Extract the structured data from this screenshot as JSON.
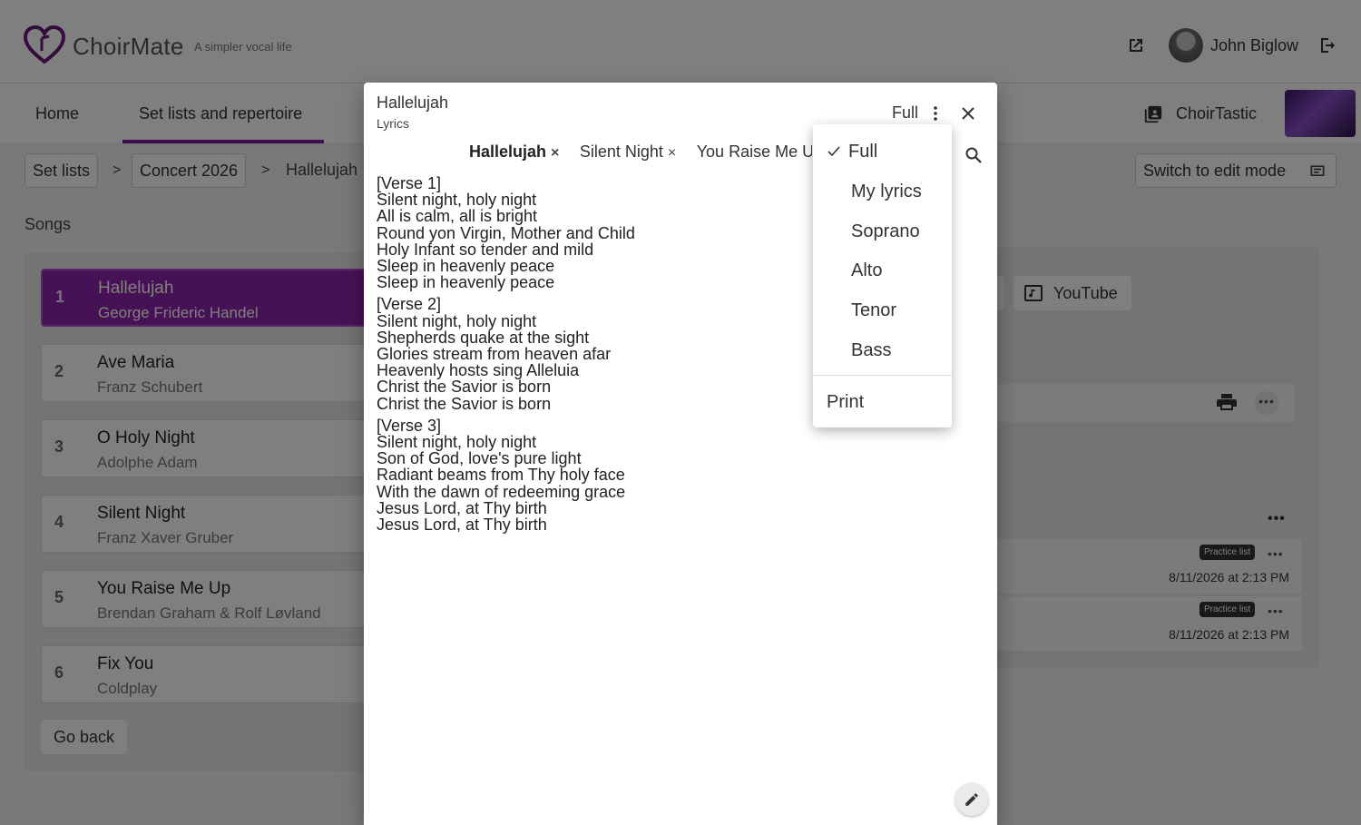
{
  "header": {
    "brand": "ChoirMate",
    "tagline": "A simpler vocal life",
    "user_name": "John Biglow"
  },
  "nav": {
    "tabs": [
      {
        "label": "Home"
      },
      {
        "label": "Set lists and repertoire"
      }
    ],
    "choir_name": "ChoirTastic"
  },
  "breadcrumb": {
    "items": [
      "Set lists",
      "Concert 2026",
      "Hallelujah"
    ],
    "separator": ">"
  },
  "edit_mode_label": "Switch to edit mode",
  "songs_heading": "Songs",
  "songs": [
    {
      "num": "1",
      "title": "Hallelujah",
      "composer": "George Frideric Handel"
    },
    {
      "num": "2",
      "title": "Ave Maria",
      "composer": "Franz Schubert"
    },
    {
      "num": "3",
      "title": "O Holy Night",
      "composer": "Adolphe Adam"
    },
    {
      "num": "4",
      "title": "Silent Night",
      "composer": "Franz Xaver Gruber"
    },
    {
      "num": "5",
      "title": "You Raise Me Up",
      "composer": "Brendan Graham & Rolf Løvland"
    },
    {
      "num": "6",
      "title": "Fix You",
      "composer": "Coldplay"
    }
  ],
  "go_back_label": "Go back",
  "details": {
    "youtube_label": "YouTube",
    "more_dots": "•••",
    "practice_rows": [
      {
        "badge": "Practice list",
        "date": "8/11/2026 at 2:13 PM"
      },
      {
        "badge": "Practice list",
        "date": "8/11/2026 at 2:13 PM"
      }
    ]
  },
  "dialog": {
    "title": "Hallelujah",
    "subtitle": "Lyrics",
    "view_mode": "Full",
    "close_glyph": "×",
    "song_tabs": [
      {
        "label": "Hallelujah"
      },
      {
        "label": "Silent Night"
      },
      {
        "label": "You Raise Me Up"
      }
    ],
    "lyrics": [
      [
        "[Verse 1]",
        "Silent night, holy night",
        "All is calm, all is bright",
        "Round yon Virgin, Mother and Child",
        "Holy Infant so tender and mild",
        "Sleep in heavenly peace",
        "Sleep in heavenly peace"
      ],
      [
        "[Verse 2]",
        "Silent night, holy night",
        "Shepherds quake at the sight",
        "Glories stream from heaven afar",
        "Heavenly hosts sing Alleluia",
        "Christ the Savior is born",
        "Christ the Savior is born"
      ],
      [
        "[Verse 3]",
        "Silent night, holy night",
        "Son of God, love's pure light",
        "Radiant beams from Thy holy face",
        "With the dawn of redeeming grace",
        "Jesus Lord, at Thy birth",
        "Jesus Lord, at Thy birth"
      ]
    ]
  },
  "menu": {
    "items": [
      "Full",
      "My lyrics",
      "Soprano",
      "Alto",
      "Tenor",
      "Bass"
    ],
    "selected": "Full",
    "print_label": "Print"
  },
  "colors": {
    "accent": "#8e24aa",
    "nav_underline": "#7b1fa2"
  }
}
